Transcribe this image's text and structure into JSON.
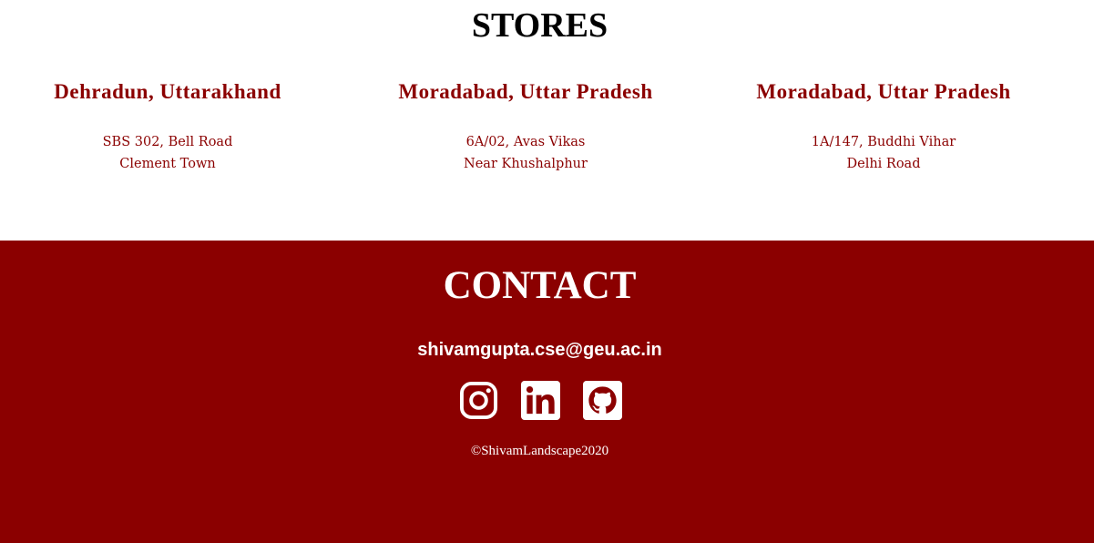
{
  "stores": {
    "title": "STORES",
    "items": [
      {
        "city": "Dehradun, Uttarakhand",
        "line1": "SBS 302, Bell Road",
        "line2": "Clement Town"
      },
      {
        "city": "Moradabad, Uttar Pradesh",
        "line1": "6A/02, Avas Vikas",
        "line2": "Near Khushalphur"
      },
      {
        "city": "Moradabad, Uttar Pradesh",
        "line1": "1A/147, Buddhi Vihar",
        "line2": "Delhi Road"
      }
    ]
  },
  "contact": {
    "title": "CONTACT",
    "email": "shivamgupta.cse@geu.ac.in",
    "socials": [
      {
        "icon": "instagram-icon"
      },
      {
        "icon": "linkedin-icon"
      },
      {
        "icon": "github-icon"
      }
    ],
    "copyright": "©ShivamLandscape2020"
  },
  "colors": {
    "brand": "#8b0000",
    "text_on_brand": "#ffffff"
  }
}
